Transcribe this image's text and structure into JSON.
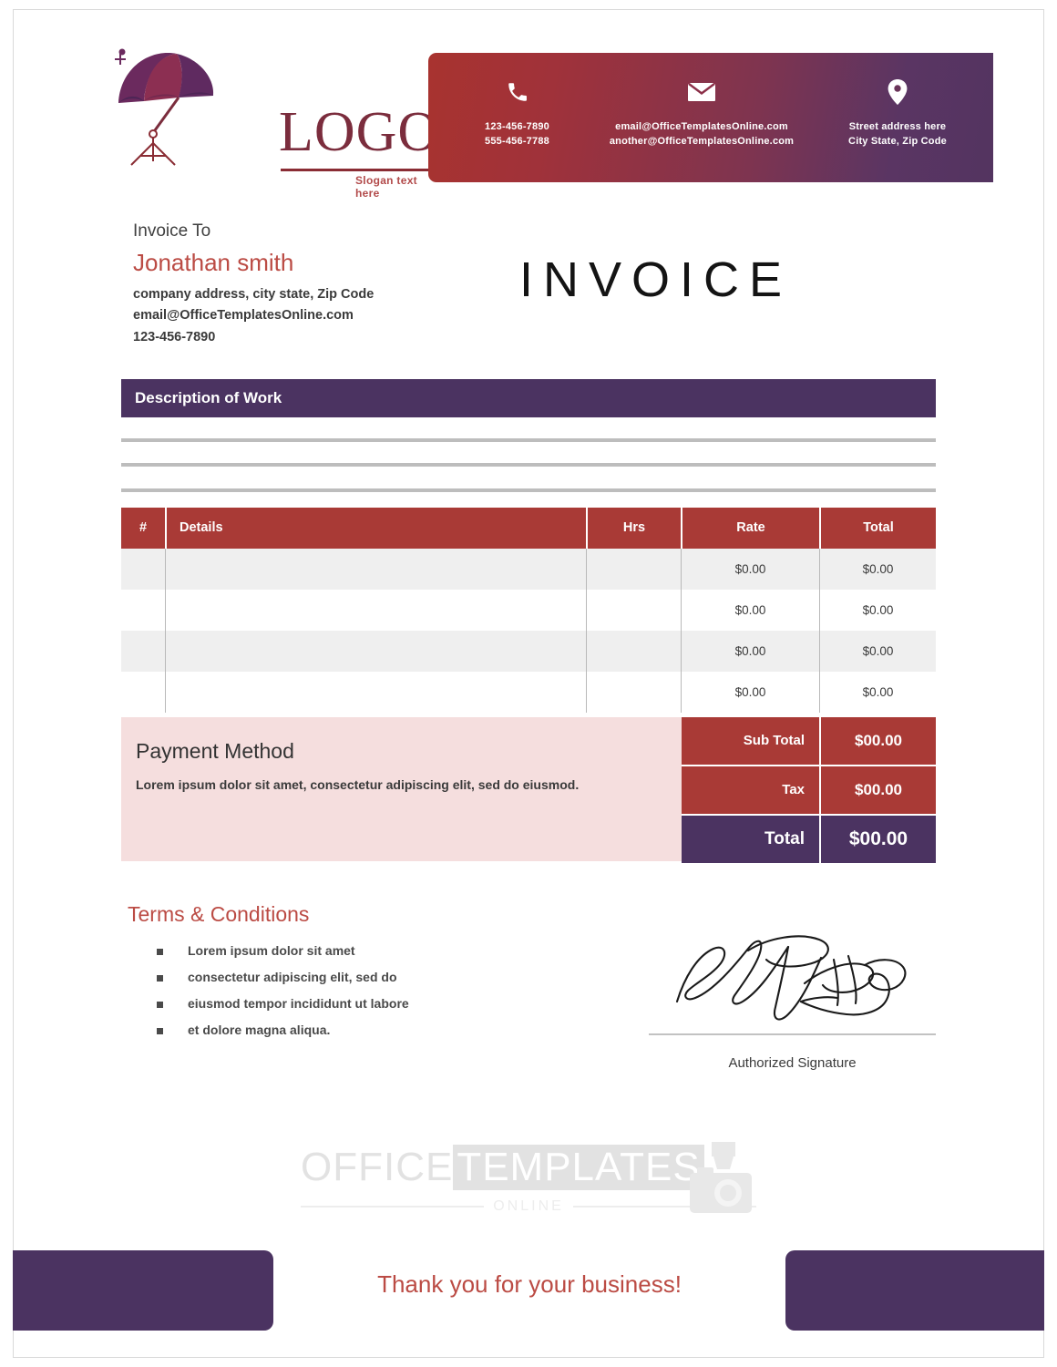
{
  "brand": {
    "logo_text": "LOGO",
    "slogan": "Slogan text here",
    "colors": {
      "red": "#A93A36",
      "purple": "#4B3361",
      "name_red": "#BB4B44",
      "pink_panel": "#F5DEDE"
    }
  },
  "header_contact": {
    "phone": {
      "icon": "phone-icon",
      "lines": [
        "123-456-7890",
        "555-456-7788"
      ]
    },
    "email": {
      "icon": "envelope-icon",
      "lines": [
        "email@OfficeTemplatesOnline.com",
        "another@OfficeTemplatesOnline.com"
      ]
    },
    "address": {
      "icon": "map-pin-icon",
      "lines": [
        "Street address here",
        "City State, Zip Code"
      ]
    }
  },
  "invoice_to": {
    "label": "Invoice To",
    "name": "Jonathan smith",
    "address": "company address, city state, Zip Code",
    "email": "email@OfficeTemplatesOnline.com",
    "phone": "123-456-7890"
  },
  "title": "INVOICE",
  "description_of_work": {
    "heading": "Description of Work"
  },
  "items_table": {
    "headers": {
      "num": "#",
      "details": "Details",
      "hrs": "Hrs",
      "rate": "Rate",
      "total": "Total"
    },
    "rows": [
      {
        "num": "",
        "details": "",
        "hrs": "",
        "rate": "$0.00",
        "total": "$0.00"
      },
      {
        "num": "",
        "details": "",
        "hrs": "",
        "rate": "$0.00",
        "total": "$0.00"
      },
      {
        "num": "",
        "details": "",
        "hrs": "",
        "rate": "$0.00",
        "total": "$0.00"
      },
      {
        "num": "",
        "details": "",
        "hrs": "",
        "rate": "$0.00",
        "total": "$0.00"
      }
    ]
  },
  "payment_method": {
    "title": "Payment Method",
    "text": "Lorem ipsum dolor sit amet, consectetur adipiscing elit, sed do eiusmod."
  },
  "totals": {
    "sub_total_label": "Sub Total",
    "sub_total_value": "$00.00",
    "tax_label": "Tax",
    "tax_value": "$00.00",
    "total_label": "Total",
    "total_value": "$00.00"
  },
  "terms": {
    "title": "Terms & Conditions",
    "items": [
      "Lorem ipsum dolor sit amet",
      "consectetur adipiscing elit, sed do",
      "eiusmod tempor incididunt ut labore",
      "et dolore magna aliqua."
    ]
  },
  "signature": {
    "caption": "Authorized Signature"
  },
  "watermark": {
    "word1": "OFFICE",
    "word2": "TEMPLATES",
    "sub": "ONLINE",
    "icon": "camera-icon"
  },
  "footer": {
    "message": "Thank you for your business!"
  }
}
